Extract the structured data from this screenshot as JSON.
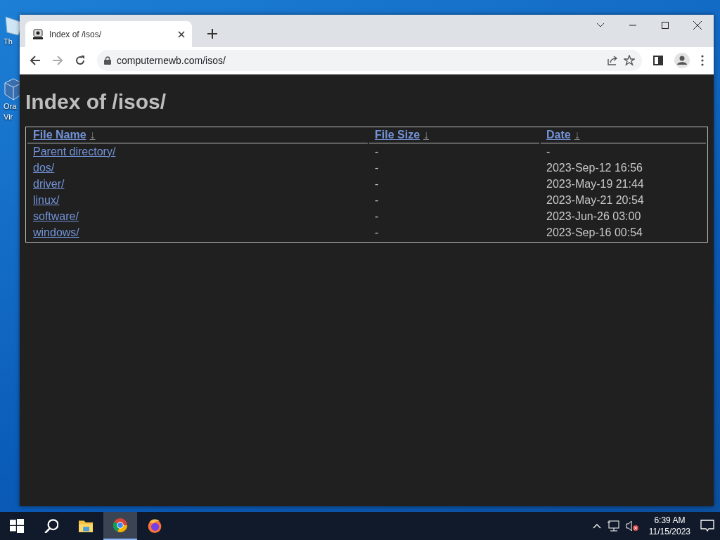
{
  "desktop_icons": [
    {
      "label_lines": [
        "Th"
      ]
    },
    {
      "label_lines": [
        "Ora",
        "Vir"
      ]
    }
  ],
  "browser": {
    "tab": {
      "title": "Index of /isos/",
      "selected": true
    },
    "url": "computernewb.com/isos/"
  },
  "page": {
    "heading": "Index of /isos/",
    "columns": [
      {
        "label": "File Name",
        "sort_arrow": "↓"
      },
      {
        "label": "File Size",
        "sort_arrow": "↓"
      },
      {
        "label": "Date",
        "sort_arrow": "↓"
      }
    ],
    "rows": [
      {
        "name": "Parent directory/",
        "size": "-",
        "date": "-"
      },
      {
        "name": "dos/",
        "size": "-",
        "date": "2023-Sep-12 16:56"
      },
      {
        "name": "driver/",
        "size": "-",
        "date": "2023-May-19 21:44"
      },
      {
        "name": "linux/",
        "size": "-",
        "date": "2023-May-21 20:54"
      },
      {
        "name": "software/",
        "size": "-",
        "date": "2023-Jun-26 03:00"
      },
      {
        "name": "windows/",
        "size": "-",
        "date": "2023-Sep-16 00:54"
      }
    ]
  },
  "taskbar": {
    "apps": [
      {
        "kind": "start",
        "selected": false
      },
      {
        "kind": "search",
        "selected": false
      },
      {
        "kind": "files",
        "selected": false
      },
      {
        "kind": "chrome",
        "selected": true
      },
      {
        "kind": "firefox",
        "selected": false
      }
    ],
    "clock": {
      "time": "6:39 AM",
      "date": "11/15/2023"
    }
  }
}
